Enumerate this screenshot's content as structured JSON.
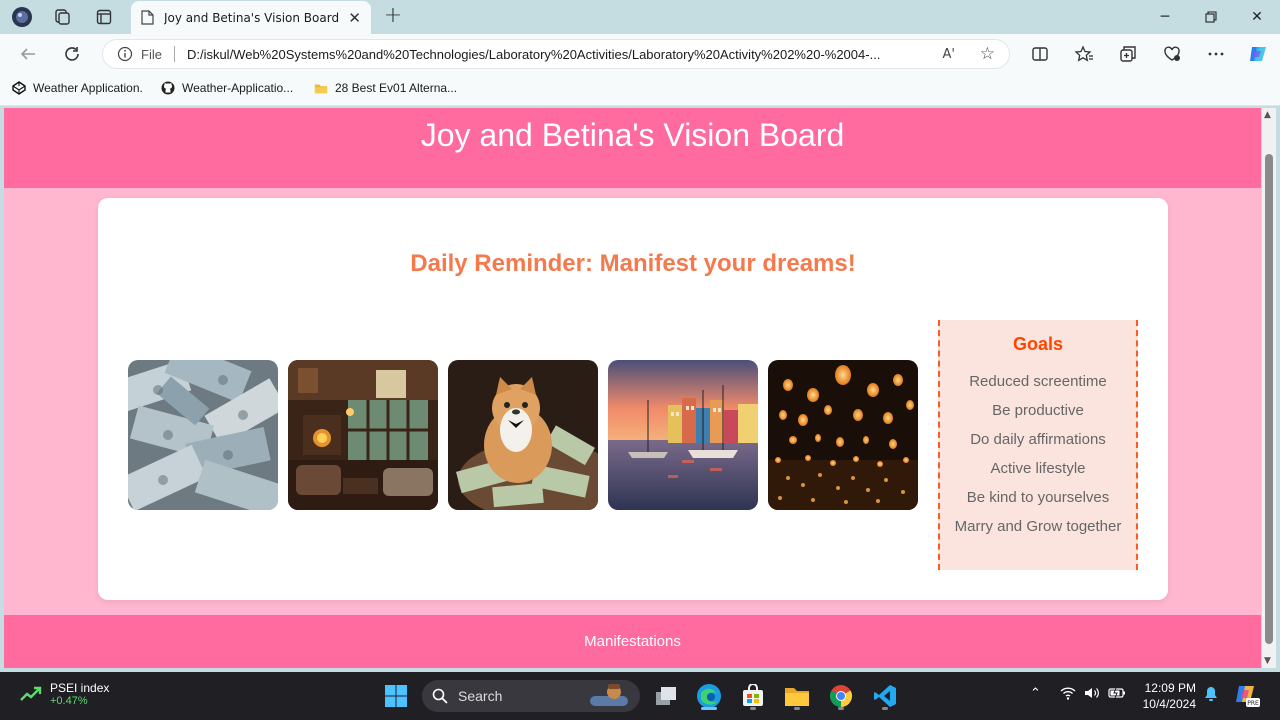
{
  "browser": {
    "tab_title": "Joy and Betina's Vision Board",
    "url_scheme": "File",
    "url": "D:/iskul/Web%20Systems%20and%20Technologies/Laboratory%20Activities/Laboratory%20Activity%202%20-%2004-...",
    "read_aloud": "A'",
    "bookmarks": [
      {
        "label": "Weather Application.",
        "icon": "codepen-icon"
      },
      {
        "label": "Weather-Applicatio...",
        "icon": "github-icon"
      },
      {
        "label": "28 Best Ev01 Alterna...",
        "icon": "folder-icon"
      }
    ]
  },
  "page": {
    "header_title": "Joy and Betina's Vision Board",
    "reminder": "Daily Reminder: Manifest your dreams!",
    "photos": [
      {
        "subject": "stacks of money"
      },
      {
        "subject": "cozy cabin living room"
      },
      {
        "subject": "cat with money"
      },
      {
        "subject": "colorful harbor at sunset"
      },
      {
        "subject": "sky lanterns at night"
      }
    ],
    "goals": {
      "title": "Goals",
      "items": [
        "Reduced screentime",
        "Be productive",
        "Do daily affirmations",
        "Active lifestyle",
        "Be kind to yourselves",
        "Marry and Grow together"
      ]
    },
    "footer": "Manifestations",
    "colors": {
      "header": "#ff6b9e",
      "background": "#ffb6cf",
      "accent": "#f47a4e",
      "goals_border": "#ff5a1f"
    }
  },
  "taskbar": {
    "stock_name": "PSEI index",
    "stock_change": "+0.47%",
    "search_placeholder": "Search",
    "time": "12:09 PM",
    "date": "10/4/2024"
  }
}
